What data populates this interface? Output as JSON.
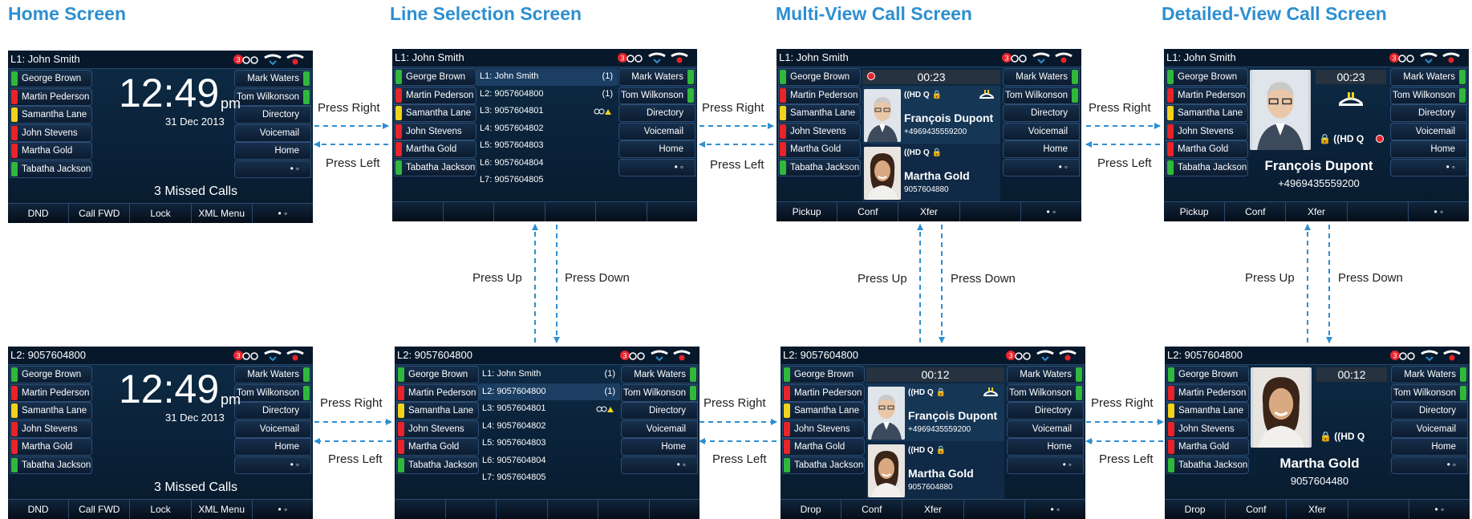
{
  "titles": [
    "Home Screen",
    "Line Selection Screen",
    "Multi-View Call Screen",
    "Detailed-View Call Screen"
  ],
  "left_buttons": [
    {
      "label": "George Brown",
      "led": "#2fb83c"
    },
    {
      "label": "Martin Pederson",
      "led": "#e8232a"
    },
    {
      "label": "Samantha Lane",
      "led": "#f2d21a"
    },
    {
      "label": "John Stevens",
      "led": "#e8232a"
    },
    {
      "label": "Martha Gold",
      "led": "#e8232a"
    },
    {
      "label": "Tabatha Jackson",
      "led": "#2fb83c"
    }
  ],
  "right_buttons": [
    {
      "label": "Mark Waters",
      "led": "#2fb83c"
    },
    {
      "label": "Tom Wilkonson",
      "led": "#2fb83c"
    },
    {
      "label": "Directory",
      "led": ""
    },
    {
      "label": "Voicemail",
      "led": ""
    },
    {
      "label": "Home",
      "led": ""
    },
    {
      "label": "• ◦",
      "led": ""
    }
  ],
  "top_row": {
    "header": "L1: John Smith",
    "home": {
      "time": "12:49",
      "ampm": "pm",
      "date": "31 Dec 2013",
      "missed": "3 Missed Calls",
      "softkeys": [
        "DND",
        "Call FWD",
        "Lock",
        "XML Menu",
        "• ◦"
      ]
    },
    "line_selection": {
      "lines": [
        {
          "label": "L1: John Smith",
          "count": "(1)"
        },
        {
          "label": "L2: 9057604800",
          "count": "(1)"
        },
        {
          "label": "L3: 9057604801",
          "count": ""
        },
        {
          "label": "L4: 9057604802",
          "count": ""
        },
        {
          "label": "L5: 9057604803",
          "count": ""
        },
        {
          "label": "L6: 9057604804",
          "count": ""
        },
        {
          "label": "L7: 9057604805",
          "count": ""
        }
      ],
      "selected_index": 0,
      "softkeys": [
        "",
        "",
        "",
        "",
        "",
        ""
      ]
    },
    "multi_view": {
      "timer": "00:23",
      "calls": [
        {
          "name": "François Dupont",
          "number": "+4969435559200",
          "codec": "((HD Q 🔒"
        },
        {
          "name": "Martha Gold",
          "number": "9057604880",
          "codec": "((HD Q 🔒"
        }
      ],
      "softkeys": [
        "Pickup",
        "Conf",
        "Xfer",
        "",
        "• ◦"
      ]
    },
    "detailed_view": {
      "timer": "00:23",
      "name": "François Dupont",
      "number": "+4969435559200",
      "softkeys": [
        "Pickup",
        "Conf",
        "Xfer",
        "",
        "• ◦"
      ]
    }
  },
  "bottom_row": {
    "header": "L2: 9057604800",
    "home": {
      "time": "12:49",
      "ampm": "pm",
      "date": "31 Dec 2013",
      "missed": "3 Missed Calls",
      "softkeys": [
        "DND",
        "Call FWD",
        "Lock",
        "XML Menu",
        "• ◦"
      ]
    },
    "line_selection": {
      "lines": [
        {
          "label": "L1: John Smith",
          "count": "(1)"
        },
        {
          "label": "L2: 9057604800",
          "count": "(1)"
        },
        {
          "label": "L3: 9057604801",
          "count": ""
        },
        {
          "label": "L4: 9057604802",
          "count": ""
        },
        {
          "label": "L5: 9057604803",
          "count": ""
        },
        {
          "label": "L6: 9057604804",
          "count": ""
        },
        {
          "label": "L7: 9057604805",
          "count": ""
        }
      ],
      "selected_index": 1,
      "softkeys": [
        "",
        "",
        "",
        "",
        "",
        ""
      ]
    },
    "multi_view": {
      "timer": "00:12",
      "calls": [
        {
          "name": "François Dupont",
          "number": "+4969435559200",
          "codec": "((HD Q 🔒"
        },
        {
          "name": "Martha Gold",
          "number": "9057604880",
          "codec": "((HD Q 🔒"
        }
      ],
      "softkeys": [
        "Drop",
        "Conf",
        "Xfer",
        "",
        "• ◦"
      ]
    },
    "detailed_view": {
      "timer": "00:12",
      "name": "Martha Gold",
      "number": "9057604480",
      "softkeys": [
        "Drop",
        "Conf",
        "Xfer",
        "",
        "• ◦"
      ]
    }
  },
  "arrows": {
    "press_right": "Press Right",
    "press_left": "Press Left",
    "press_up": "Press Up",
    "press_down": "Press Down"
  },
  "colors": {
    "title": "#2e8fd0",
    "arrow": "#2e8fd0",
    "screen_bg": "#0a2138"
  }
}
